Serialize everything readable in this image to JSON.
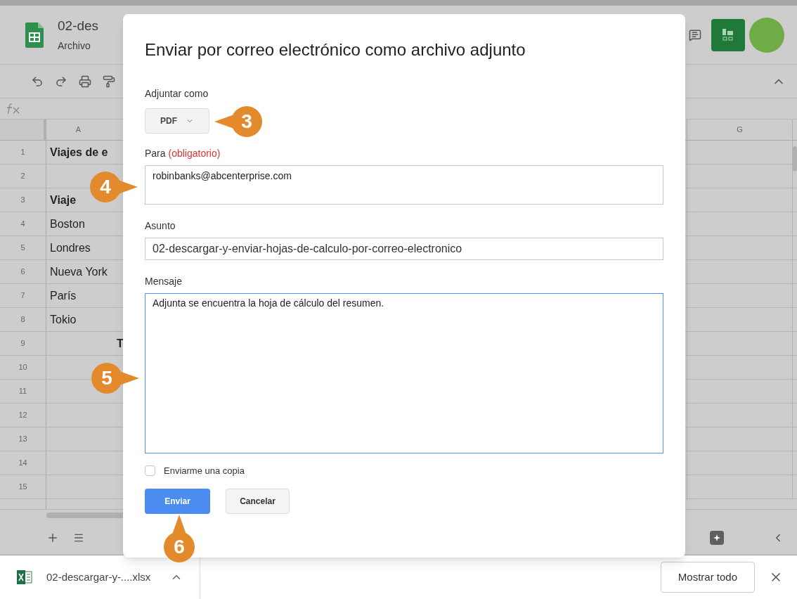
{
  "app": {
    "title": "02-des",
    "menu": [
      "Archivo"
    ]
  },
  "sheet": {
    "columns": [
      "A",
      "G"
    ],
    "rows": [
      {
        "number": "1",
        "text": "Viajes de e",
        "bold": true,
        "kind": "left"
      },
      {
        "number": "2"
      },
      {
        "number": "3",
        "text": "Viaje",
        "bold": true,
        "kind": "left"
      },
      {
        "number": "4",
        "text": "Boston",
        "bold": false,
        "kind": "left"
      },
      {
        "number": "5",
        "text": "Londres",
        "bold": false,
        "kind": "left"
      },
      {
        "number": "6",
        "text": "Nueva York",
        "bold": false,
        "kind": "left"
      },
      {
        "number": "7",
        "text": "París",
        "bold": false,
        "kind": "left"
      },
      {
        "number": "8",
        "text": "Tokio",
        "bold": false,
        "kind": "left"
      },
      {
        "number": "9",
        "text": "T",
        "bold": true,
        "kind": "total"
      },
      {
        "number": "10"
      },
      {
        "number": "11"
      },
      {
        "number": "12"
      },
      {
        "number": "13"
      },
      {
        "number": "14"
      },
      {
        "number": "15"
      }
    ]
  },
  "dialog": {
    "title": "Enviar por correo electrónico como archivo adjunto",
    "attach_label": "Adjuntar como",
    "format": "PDF",
    "to_label": "Para",
    "to_required": "(obligatorio)",
    "to_value": "robinbanks@abcenterprise.com",
    "subject_label": "Asunto",
    "subject_value": "02-descargar-y-enviar-hojas-de-calculo-por-correo-electronico",
    "message_label": "Mensaje",
    "message_value": "Adjunta se encuentra la hoja de cálculo del resumen.",
    "message_focused": true,
    "copy": {
      "label": "Enviarme una copia",
      "checked": false
    },
    "send": "Enviar",
    "cancel": "Cancelar"
  },
  "callouts": [
    {
      "label": "3"
    },
    {
      "label": "4"
    },
    {
      "label": "5"
    },
    {
      "label": "6"
    }
  ],
  "download_bar": {
    "file": "02-descargar-y-....xlsx",
    "show_all": "Mostrar todo"
  }
}
